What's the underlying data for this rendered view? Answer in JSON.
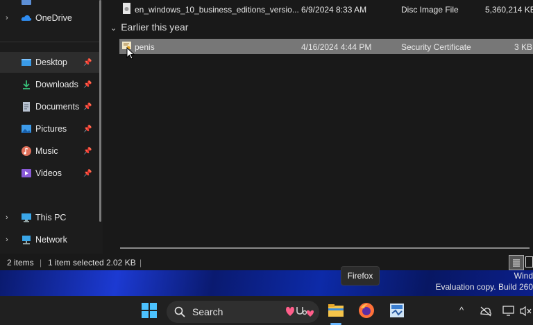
{
  "sidebar": {
    "items": [
      {
        "label": "OneDrive",
        "chevron": "›",
        "icon": "onedrive-cloud-icon"
      },
      {
        "label": "Desktop",
        "pin": "📌",
        "icon": "desktop-icon"
      },
      {
        "label": "Downloads",
        "pin": "📌",
        "icon": "download-arrow-icon"
      },
      {
        "label": "Documents",
        "pin": "📌",
        "icon": "document-icon"
      },
      {
        "label": "Pictures",
        "pin": "📌",
        "icon": "pictures-icon"
      },
      {
        "label": "Music",
        "pin": "📌",
        "icon": "music-icon"
      },
      {
        "label": "Videos",
        "pin": "📌",
        "icon": "videos-icon"
      },
      {
        "label": "This PC",
        "chevron": "›",
        "icon": "monitor-icon"
      },
      {
        "label": "Network",
        "chevron": "›",
        "icon": "network-icon"
      }
    ]
  },
  "files": {
    "top_row": {
      "name": "en_windows_10_business_editions_versio...",
      "date": "6/9/2024 8:33 AM",
      "type": "Disc Image File",
      "size": "5,360,214 KB"
    },
    "group_label": "Earlier this year",
    "group_chevron": "⌄",
    "selected_row": {
      "name": "penis",
      "date": "4/16/2024 4:44 PM",
      "type": "Security Certificate",
      "size": "3 KB"
    }
  },
  "status": {
    "items": "2 items",
    "selected": "1 item selected",
    "size": "2.02 KB"
  },
  "desktop": {
    "watermark_line1": "Wind",
    "watermark_line2": "Evaluation copy. Build 260"
  },
  "tooltip": {
    "text": "Firefox"
  },
  "taskbar": {
    "search_label": "Search",
    "tray_chevron": "^"
  },
  "colors": {
    "accent": "#0078d4",
    "selected_row": "#777777"
  }
}
